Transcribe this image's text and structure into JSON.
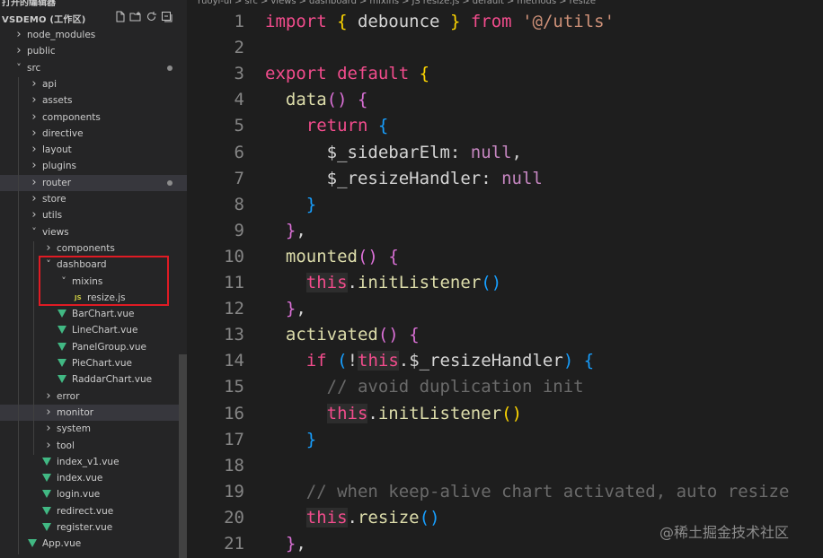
{
  "explorer": {
    "top_title": "打开的编辑器",
    "workspace_title": "VSDEMO (工作区)",
    "actions": [
      "new-file-icon",
      "new-folder-icon",
      "refresh-icon",
      "collapse-all-icon"
    ],
    "items": [
      {
        "label": "node_modules",
        "depth": 0,
        "type": "folder",
        "expanded": false
      },
      {
        "label": "public",
        "depth": 0,
        "type": "folder",
        "expanded": false
      },
      {
        "label": "src",
        "depth": 0,
        "type": "folder",
        "expanded": true,
        "modified": true
      },
      {
        "label": "api",
        "depth": 1,
        "type": "folder",
        "expanded": false
      },
      {
        "label": "assets",
        "depth": 1,
        "type": "folder",
        "expanded": false
      },
      {
        "label": "components",
        "depth": 1,
        "type": "folder",
        "expanded": false
      },
      {
        "label": "directive",
        "depth": 1,
        "type": "folder",
        "expanded": false
      },
      {
        "label": "layout",
        "depth": 1,
        "type": "folder",
        "expanded": false
      },
      {
        "label": "plugins",
        "depth": 1,
        "type": "folder",
        "expanded": false
      },
      {
        "label": "router",
        "depth": 1,
        "type": "folder",
        "expanded": false,
        "modified": true,
        "selected": true
      },
      {
        "label": "store",
        "depth": 1,
        "type": "folder",
        "expanded": false
      },
      {
        "label": "utils",
        "depth": 1,
        "type": "folder",
        "expanded": false
      },
      {
        "label": "views",
        "depth": 1,
        "type": "folder",
        "expanded": true
      },
      {
        "label": "components",
        "depth": 2,
        "type": "folder",
        "expanded": false
      },
      {
        "label": "dashboard",
        "depth": 2,
        "type": "folder",
        "expanded": true
      },
      {
        "label": "mixins",
        "depth": 3,
        "type": "folder",
        "expanded": true
      },
      {
        "label": "resize.js",
        "depth": 4,
        "type": "js"
      },
      {
        "label": "BarChart.vue",
        "depth": 3,
        "type": "vue"
      },
      {
        "label": "LineChart.vue",
        "depth": 3,
        "type": "vue"
      },
      {
        "label": "PanelGroup.vue",
        "depth": 3,
        "type": "vue"
      },
      {
        "label": "PieChart.vue",
        "depth": 3,
        "type": "vue"
      },
      {
        "label": "RaddarChart.vue",
        "depth": 3,
        "type": "vue"
      },
      {
        "label": "error",
        "depth": 2,
        "type": "folder",
        "expanded": false
      },
      {
        "label": "monitor",
        "depth": 2,
        "type": "folder",
        "expanded": false,
        "selected": true
      },
      {
        "label": "system",
        "depth": 2,
        "type": "folder",
        "expanded": false
      },
      {
        "label": "tool",
        "depth": 2,
        "type": "folder",
        "expanded": false
      },
      {
        "label": "index_v1.vue",
        "depth": 2,
        "type": "vue"
      },
      {
        "label": "index.vue",
        "depth": 2,
        "type": "vue"
      },
      {
        "label": "login.vue",
        "depth": 2,
        "type": "vue"
      },
      {
        "label": "redirect.vue",
        "depth": 2,
        "type": "vue"
      },
      {
        "label": "register.vue",
        "depth": 2,
        "type": "vue"
      },
      {
        "label": "App.vue",
        "depth": 1,
        "type": "vue"
      }
    ]
  },
  "breadcrumb": [
    "ruoyi-ui",
    ">",
    "src",
    ">",
    "views",
    ">",
    "dashboard",
    ">",
    "mixins",
    ">",
    "JS",
    "resize.js",
    ">",
    "default",
    ">",
    "methods",
    ">",
    "resize"
  ],
  "icons": {
    "js_badge": "JS"
  },
  "colors": {
    "accent_highlight": "#e01b24",
    "vue_icon": "#41b883",
    "js_icon": "#cbcb41"
  },
  "code": {
    "lines": [
      {
        "n": "1",
        "tokens": [
          [
            "kw2",
            "import"
          ],
          [
            "pun",
            " "
          ],
          [
            "br1",
            "{"
          ],
          [
            "pun",
            " debounce "
          ],
          [
            "br1",
            "}"
          ],
          [
            "pun",
            " "
          ],
          [
            "kw2",
            "from"
          ],
          [
            "pun",
            " "
          ],
          [
            "str",
            "'@/utils'"
          ]
        ]
      },
      {
        "n": "2",
        "tokens": []
      },
      {
        "n": "3",
        "tokens": [
          [
            "kw2",
            "export"
          ],
          [
            "pun",
            " "
          ],
          [
            "kw2",
            "default"
          ],
          [
            "pun",
            " "
          ],
          [
            "br1",
            "{"
          ]
        ]
      },
      {
        "n": "4",
        "tokens": [
          [
            "pun",
            "  "
          ],
          [
            "fn",
            "data"
          ],
          [
            "br2",
            "()"
          ],
          [
            "pun",
            " "
          ],
          [
            "br2",
            "{"
          ]
        ]
      },
      {
        "n": "5",
        "tokens": [
          [
            "pun",
            "    "
          ],
          [
            "kw2",
            "return"
          ],
          [
            "pun",
            " "
          ],
          [
            "br3",
            "{"
          ]
        ]
      },
      {
        "n": "6",
        "tokens": [
          [
            "pun",
            "      $_sidebarElm: "
          ],
          [
            "null",
            "null"
          ],
          [
            "pun",
            ","
          ]
        ]
      },
      {
        "n": "7",
        "tokens": [
          [
            "pun",
            "      $_resizeHandler: "
          ],
          [
            "null",
            "null"
          ]
        ]
      },
      {
        "n": "8",
        "tokens": [
          [
            "pun",
            "    "
          ],
          [
            "br3",
            "}"
          ]
        ]
      },
      {
        "n": "9",
        "tokens": [
          [
            "pun",
            "  "
          ],
          [
            "br2",
            "}"
          ],
          [
            "pun",
            ","
          ]
        ]
      },
      {
        "n": "10",
        "tokens": [
          [
            "pun",
            "  "
          ],
          [
            "fn",
            "mounted"
          ],
          [
            "br2",
            "()"
          ],
          [
            "pun",
            " "
          ],
          [
            "br2",
            "{"
          ]
        ]
      },
      {
        "n": "11",
        "tokens": [
          [
            "pun",
            "    "
          ],
          [
            "this",
            "this"
          ],
          [
            "pun",
            "."
          ],
          [
            "fn",
            "initListener"
          ],
          [
            "br3",
            "()"
          ]
        ]
      },
      {
        "n": "12",
        "tokens": [
          [
            "pun",
            "  "
          ],
          [
            "br2",
            "}"
          ],
          [
            "pun",
            ","
          ]
        ]
      },
      {
        "n": "13",
        "tokens": [
          [
            "pun",
            "  "
          ],
          [
            "fn",
            "activated"
          ],
          [
            "br2",
            "()"
          ],
          [
            "pun",
            " "
          ],
          [
            "br2",
            "{"
          ]
        ]
      },
      {
        "n": "14",
        "tokens": [
          [
            "pun",
            "    "
          ],
          [
            "kw2",
            "if"
          ],
          [
            "pun",
            " "
          ],
          [
            "br3",
            "("
          ],
          [
            "pun",
            "!"
          ],
          [
            "this",
            "this"
          ],
          [
            "pun",
            ".$_resizeHandler"
          ],
          [
            "br3",
            ")"
          ],
          [
            "pun",
            " "
          ],
          [
            "br3",
            "{"
          ]
        ]
      },
      {
        "n": "15",
        "tokens": [
          [
            "pun",
            "      "
          ],
          [
            "cmt",
            "// avoid duplication init"
          ]
        ]
      },
      {
        "n": "16",
        "tokens": [
          [
            "pun",
            "      "
          ],
          [
            "this",
            "this"
          ],
          [
            "pun",
            "."
          ],
          [
            "fn",
            "initListener"
          ],
          [
            "br1",
            "()"
          ]
        ]
      },
      {
        "n": "17",
        "tokens": [
          [
            "pun",
            "    "
          ],
          [
            "br3",
            "}"
          ]
        ]
      },
      {
        "n": "18",
        "tokens": []
      },
      {
        "n": "19",
        "tokens": [
          [
            "pun",
            "    "
          ],
          [
            "cmt",
            "// when keep-alive chart activated, auto resize"
          ]
        ]
      },
      {
        "n": "20",
        "tokens": [
          [
            "pun",
            "    "
          ],
          [
            "this",
            "this"
          ],
          [
            "pun",
            "."
          ],
          [
            "fn",
            "resize"
          ],
          [
            "br3",
            "()"
          ]
        ]
      },
      {
        "n": "21",
        "tokens": [
          [
            "pun",
            "  "
          ],
          [
            "br2",
            "}"
          ],
          [
            "pun",
            ","
          ]
        ]
      }
    ]
  },
  "watermark": "@稀土掘金技术社区"
}
